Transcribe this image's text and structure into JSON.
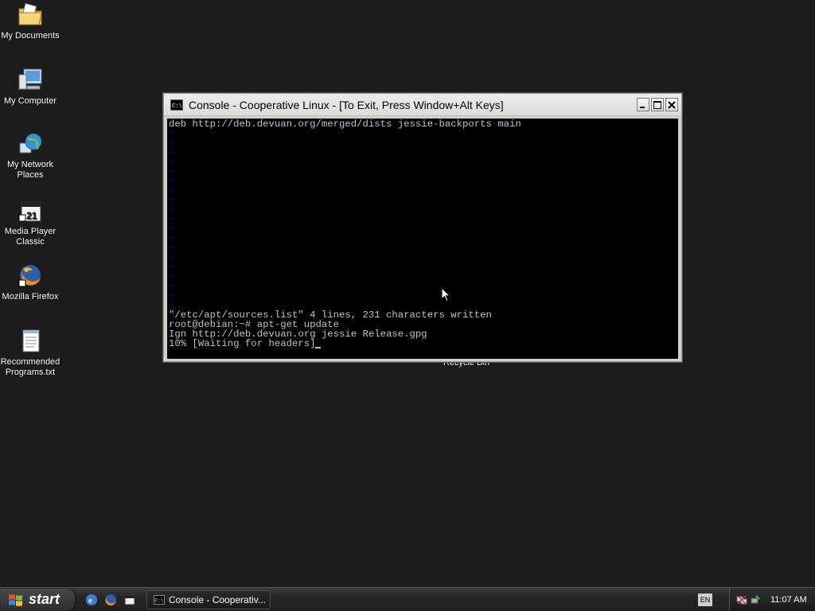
{
  "desktop": {
    "icons": [
      {
        "label": "My Documents"
      },
      {
        "label": "My Computer"
      },
      {
        "label": "My Network Places"
      },
      {
        "label": "Media Player Classic"
      },
      {
        "label": "Mozilla Firefox"
      },
      {
        "label": "Recommended Programs.txt"
      }
    ],
    "partial_icon_label": "Recycle Bin"
  },
  "window": {
    "title": "Console - Cooperative Linux - [To Exit, Press Window+Alt Keys]",
    "console_lines": {
      "top": "deb http://deb.devuan.org/merged/dists jessie-backports main",
      "tilde": "~",
      "written": "\"/etc/apt/sources.list\" 4 lines, 231 characters written",
      "prompt": "root@debian:~# apt-get update",
      "ign": "Ign http://deb.devuan.org jessie Release.gpg",
      "progress": "10% [Waiting for headers]"
    }
  },
  "taskbar": {
    "start_label": "start",
    "task_item_label": "Console - Cooperativ...",
    "language": "EN",
    "clock": "11:07 AM"
  },
  "colors": {
    "desktop_bg": "#1c1c1c",
    "console_bg": "#000000",
    "console_text": "#c0c0c0",
    "vim_tilde": "#0000ff"
  }
}
